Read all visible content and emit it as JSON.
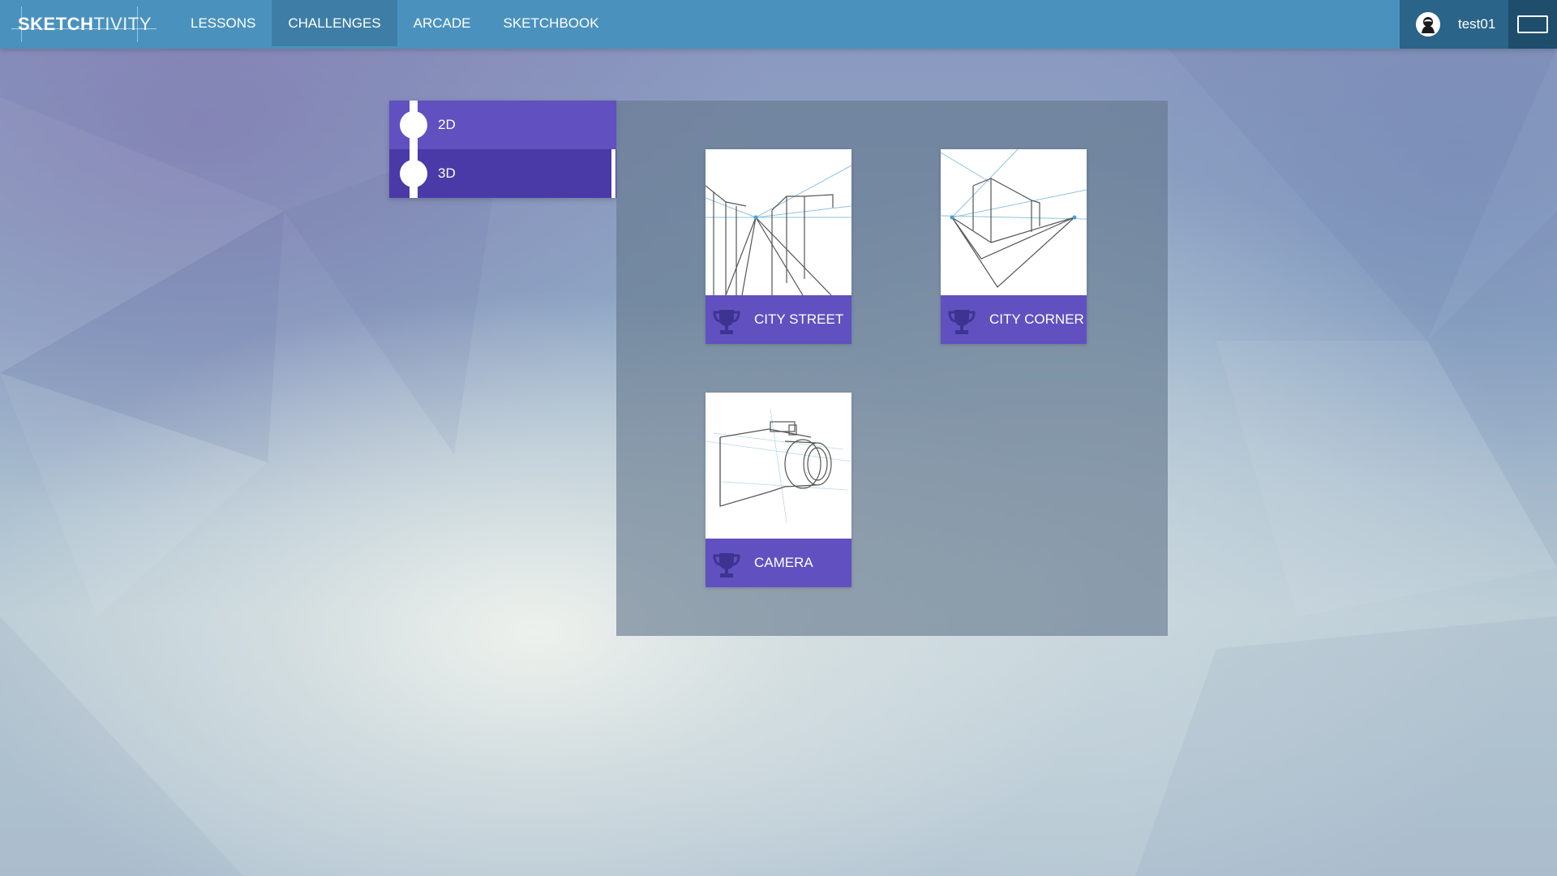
{
  "app": {
    "logo_bold": "SKETCH",
    "logo_light": "TIVITY"
  },
  "nav": {
    "items": [
      {
        "label": "LESSONS",
        "active": false
      },
      {
        "label": "CHALLENGES",
        "active": true
      },
      {
        "label": "ARCADE",
        "active": false
      },
      {
        "label": "SKETCHBOOK",
        "active": false
      }
    ]
  },
  "user": {
    "name": "test01",
    "avatar_icon": "user-avatar-icon"
  },
  "fullscreen": {
    "icon": "fullscreen-icon"
  },
  "categories": {
    "items": [
      {
        "label": "2D",
        "selected": false
      },
      {
        "label": "3D",
        "selected": true
      }
    ]
  },
  "challenges": {
    "cards": [
      {
        "title": "CITY STREET",
        "thumbnail": "city-street-sketch",
        "icon": "trophy-icon"
      },
      {
        "title": "CITY CORNER",
        "thumbnail": "city-corner-sketch",
        "icon": "trophy-icon"
      },
      {
        "title": "CAMERA",
        "thumbnail": "camera-sketch",
        "icon": "trophy-icon"
      }
    ]
  },
  "colors": {
    "nav_bar": "#4a92bd",
    "nav_active": "#3e7ea6",
    "user_bg": "#2a6488",
    "fullscreen_bg": "#1e4e6c",
    "category_2d": "#6050c0",
    "category_3d": "#4a3aa8",
    "card_bar": "#6150c0",
    "trophy": "#3d3492"
  }
}
